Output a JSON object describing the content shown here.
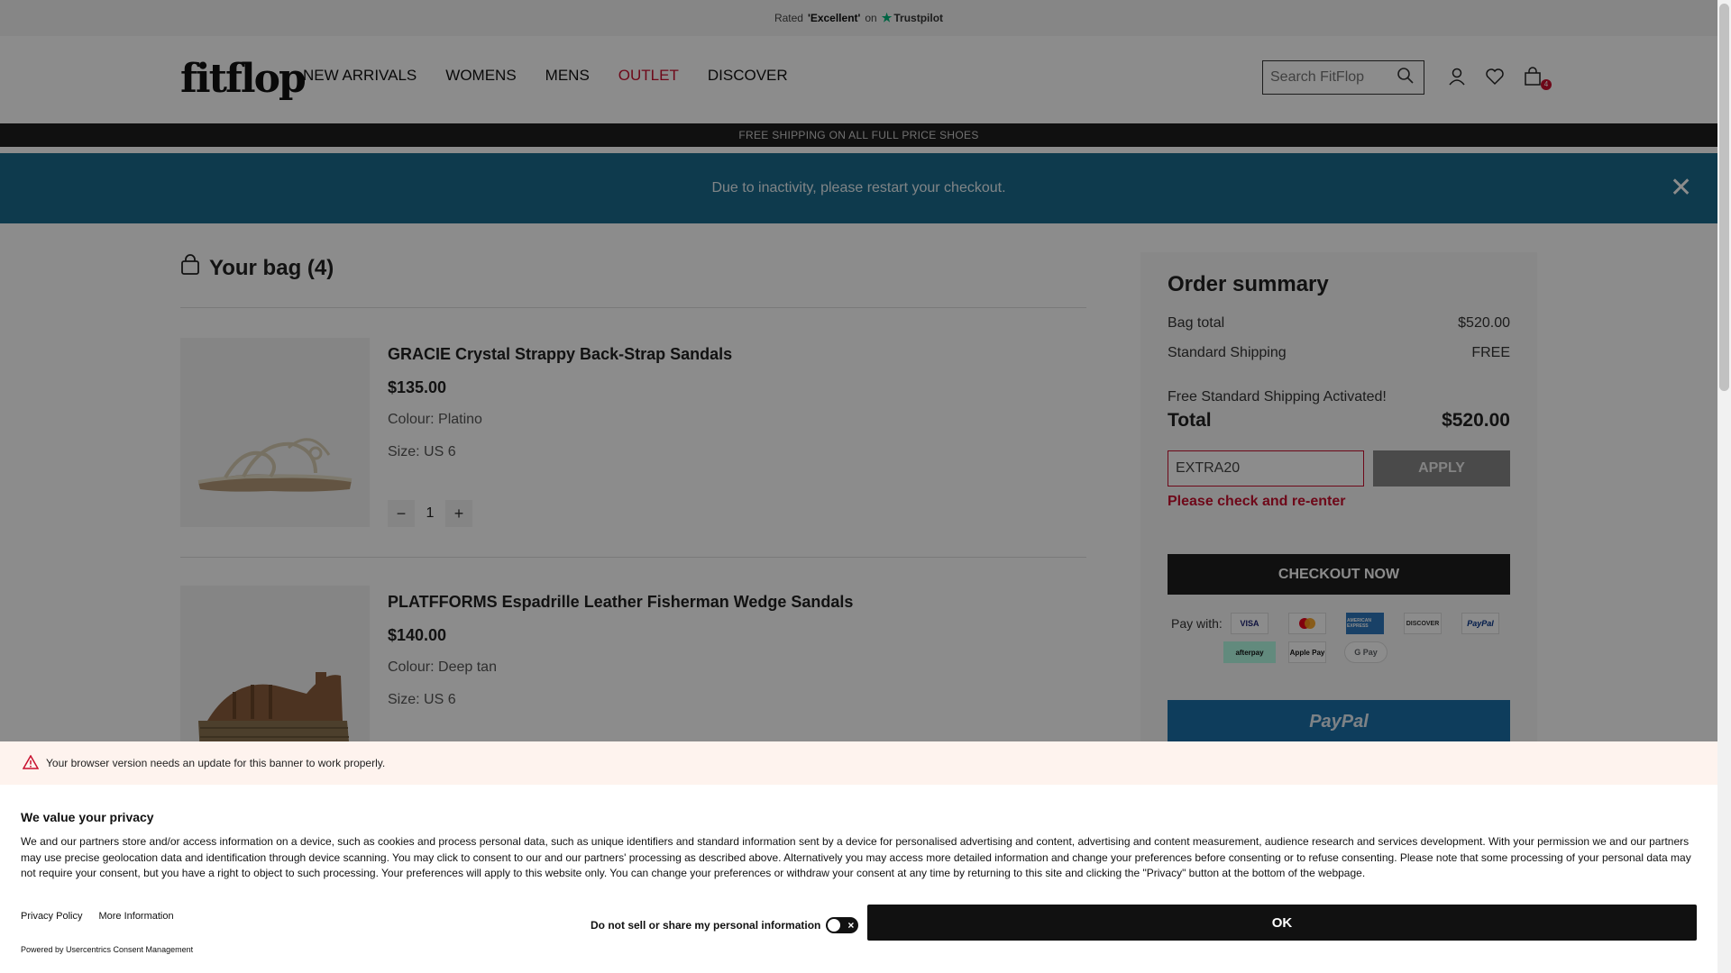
{
  "trustbar": {
    "rated": "Rated",
    "rating": "'Excellent'",
    "on": "on",
    "brand": "Trustpilot"
  },
  "header": {
    "logo": "fitflop",
    "nav": [
      "NEW ARRIVALS",
      "WOMENS",
      "MENS",
      "OUTLET",
      "DISCOVER"
    ],
    "search_placeholder": "Search FitFlop",
    "bag_count": "4"
  },
  "shipping_bar": "FREE SHIPPING ON ALL FULL PRICE SHOES",
  "alert": {
    "message": "Due to inactivity, please restart your checkout.",
    "close": "✕"
  },
  "bag": {
    "title": "Your bag (4)",
    "items": [
      {
        "name": "GRACIE Crystal Strappy Back-Strap Sandals",
        "price": "$135.00",
        "colour": "Colour: Platino",
        "size": "Size: US 6",
        "qty": "1"
      },
      {
        "name": "PLATFFORMS Espadrille Leather Fisherman Wedge Sandals",
        "price": "$140.00",
        "colour": "Colour: Deep tan",
        "size": "Size: US 6"
      }
    ]
  },
  "summary": {
    "title": "Order summary",
    "bag_total_label": "Bag total",
    "bag_total": "$520.00",
    "shipping_label": "Standard Shipping",
    "shipping": "FREE",
    "shipping_note": "Free Standard Shipping Activated!",
    "total_label": "Total",
    "total": "$520.00",
    "promo_value": "EXTRA20",
    "apply_label": "APPLY",
    "promo_error": "Please check and re-enter",
    "checkout_label": "CHECKOUT NOW",
    "pay_with": "Pay with:",
    "cards": [
      "VISA",
      "mastercard",
      "AMERICAN EXPRESS",
      "DISCOVER",
      "PayPal",
      "afterpay",
      "Apple Pay",
      "G Pay"
    ],
    "paypal_button": "PayPal"
  },
  "warning": "Your browser version needs an update for this banner to work properly.",
  "consent": {
    "title": "We value your privacy",
    "body": "We and our partners store and/or access information on a device, such as cookies and process personal data, such as unique identifiers and standard information sent by a device for personalised advertising and content, advertising and content measurement, audience research and services development. With your permission we and our partners may use precise geolocation data and identification through device scanning. You may click to consent to our and our partners' processing as described above. Alternatively you may access more detailed information and change your preferences before consenting or to refuse consenting. Please note that some processing of your personal data may not require your consent, but you have a right to object to such processing. Your preferences will apply to this website only. You can change your preferences or withdraw your consent at any time by returning to this site and clicking the \"Privacy\" button at the bottom of the webpage.",
    "privacy_policy": "Privacy Policy",
    "more_info": "More Information",
    "powered_by": "Powered by Usercentrics Consent Management",
    "do_not_sell": "Do not sell or share my personal information",
    "ok": "OK"
  },
  "colors": {
    "accent_red": "#c8102e",
    "alert_blue": "#1a6a8d",
    "dark": "#1e1e1e",
    "trustpilot_green": "#00b67a"
  }
}
